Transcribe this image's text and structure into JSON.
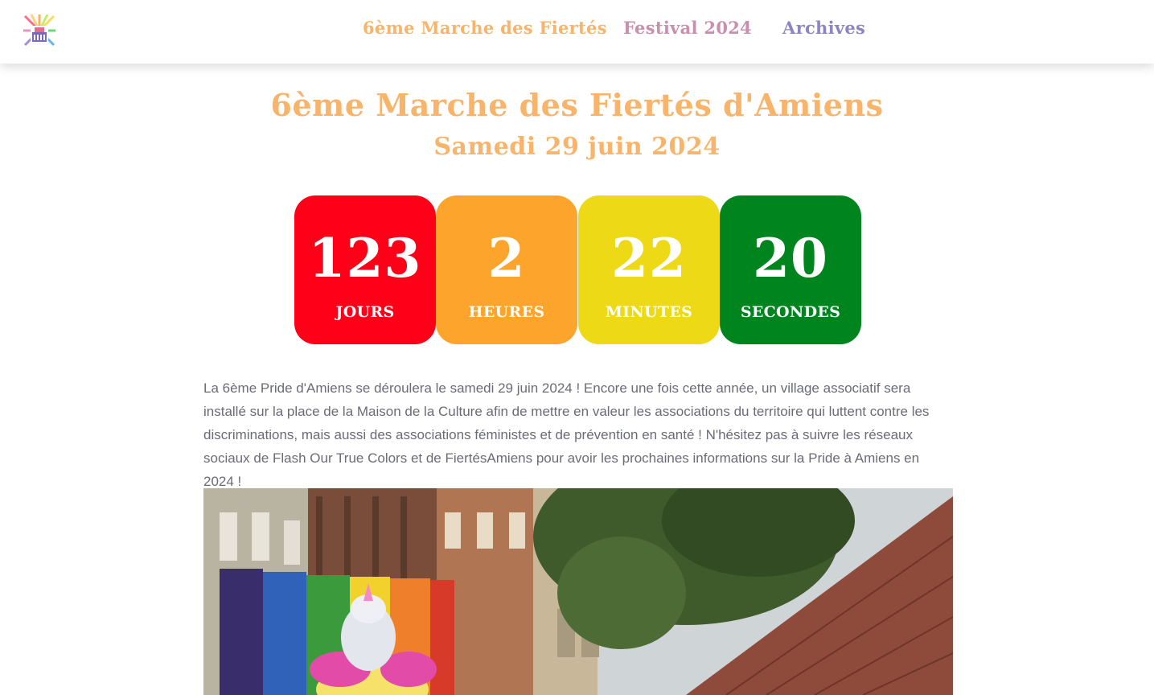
{
  "colors": {
    "orange_text": "#f8b46a",
    "pink_text": "#c98fae",
    "purple_text": "#8b86c2",
    "days_bg": "#ff0019",
    "hours_bg": "#fda42c",
    "minutes_bg": "#eed916",
    "seconds_bg": "#00841d",
    "body_text": "#6b6b78"
  },
  "header": {
    "logo_icon": "pride-logo-icon",
    "nav": [
      {
        "label": "6ème Marche des Fiertés",
        "color": "#f8b46a"
      },
      {
        "label": "Festival 2024",
        "color": "#c98fae"
      },
      {
        "label": "Archives",
        "color": "#8b86c2"
      }
    ]
  },
  "hero": {
    "title": "6ème Marche des Fiertés d'Amiens",
    "date": "Samedi 29 juin 2024"
  },
  "countdown": [
    {
      "value": "123",
      "unit": "JOURS",
      "color": "#ff0019"
    },
    {
      "value": "2",
      "unit": "HEURES",
      "color": "#fda42c"
    },
    {
      "value": "22",
      "unit": "MINUTES",
      "color": "#eed916"
    },
    {
      "value": "20",
      "unit": "SECONDES",
      "color": "#00841d"
    }
  ],
  "intro": "La 6ème Pride d'Amiens se déroulera le samedi 29 juin 2024 ! Encore une fois cette année, un village associatif sera installé sur la place de la Maison de la Culture afin de mettre en valeur les associations du territoire qui luttent contre les discriminations, mais aussi des associations féministes et de prévention en santé ! N'hésitez pas à suivre les réseaux sociaux de Flash Our True Colors et de FiertésAmiens pour avoir les prochaines informations sur la Pride à Amiens en 2024 !"
}
